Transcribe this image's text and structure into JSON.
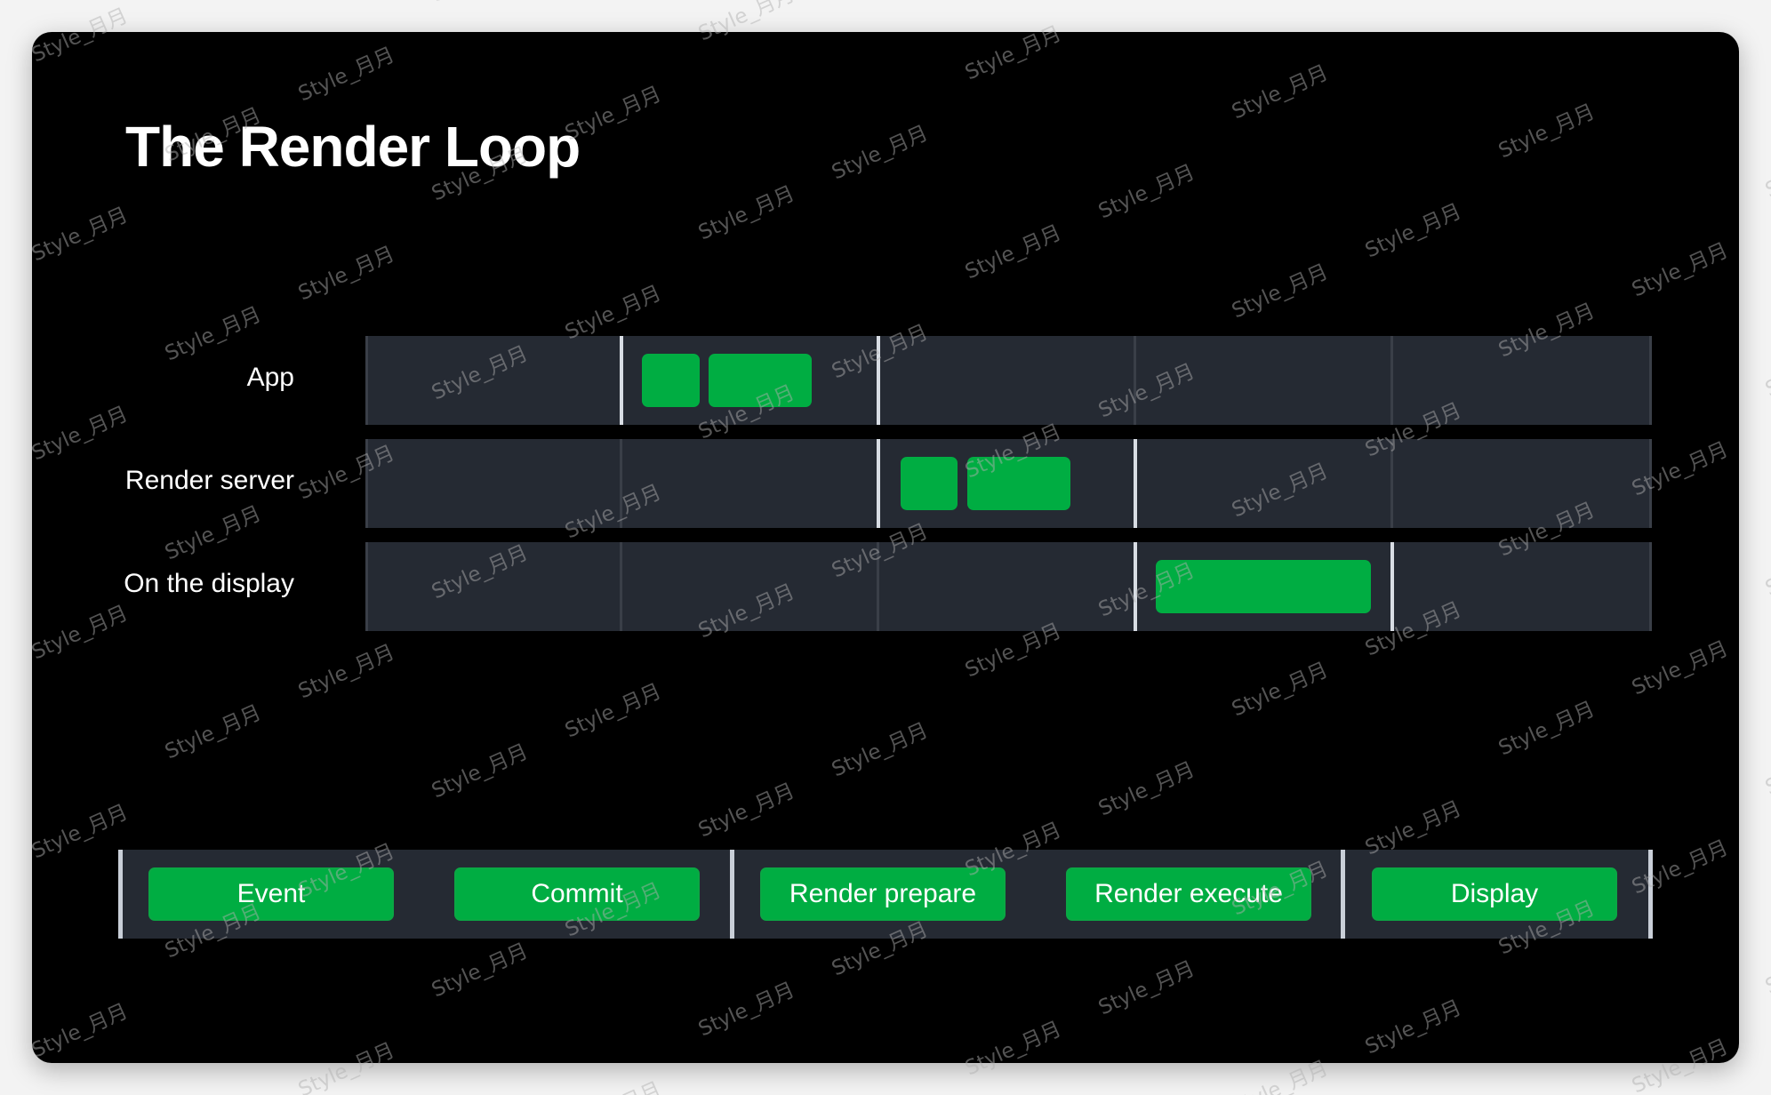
{
  "title": "The Render Loop",
  "rows": [
    {
      "label": "App"
    },
    {
      "label": "Render server"
    },
    {
      "label": "On the display"
    }
  ],
  "phases": [
    "Event",
    "Commit",
    "Render prepare",
    "Render execute",
    "Display"
  ],
  "watermark_text": "Style_月月",
  "colors": {
    "background": "#000000",
    "lane": "#252a33",
    "task": "#00ad42",
    "text": "#ffffff"
  }
}
